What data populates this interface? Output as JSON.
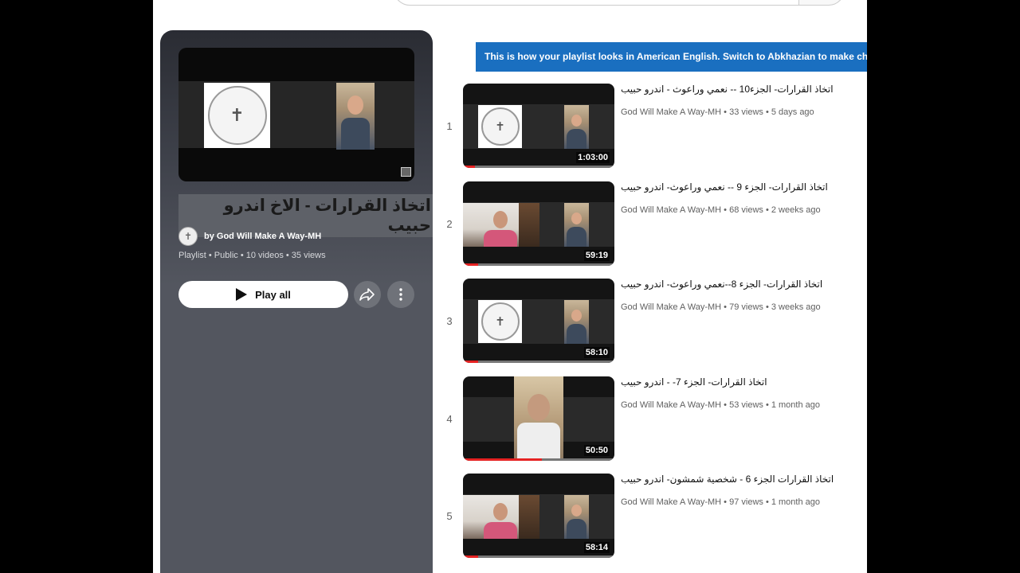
{
  "playlist": {
    "title": "اتخاذ القرارات - الاخ اندرو حبيب",
    "owner": "by God Will Make A Way-MH",
    "meta": "Playlist • Public • 10 videos • 35 views",
    "play_all_label": "Play all"
  },
  "banner": {
    "text": "This is how your playlist looks in American English. Switch to Abkhazian to make changes."
  },
  "icons": {
    "share": "share-icon",
    "more": "more-vert-icon",
    "play": "play-icon"
  },
  "videos": [
    {
      "index": "1",
      "title": "اتخاذ القرارات- الجزء10 -- نعمي وراعوث - اندرو حبيب",
      "channel": "God Will Make A Way-MH",
      "stats": "33 views • 5 days ago",
      "duration": "1:03:00",
      "progress": 0.08,
      "style": "logo"
    },
    {
      "index": "2",
      "title": "اتخاذ القرارات- الجزء 9 -- نعمي وراعوث- اندرو حبيب",
      "channel": "God Will Make A Way-MH",
      "stats": "68 views • 2 weeks ago",
      "duration": "59:19",
      "progress": 0.1,
      "style": "woman"
    },
    {
      "index": "3",
      "title": "اتخاذ القرارات- الجزء 8--نعمي وراعوث- اندرو حبيب",
      "channel": "God Will Make A Way-MH",
      "stats": "79 views • 3 weeks ago",
      "duration": "58:10",
      "progress": 0.1,
      "style": "logo"
    },
    {
      "index": "4",
      "title": "اتخاذ القرارات- الجزء 7- - اندرو حبيب",
      "channel": "God Will Make A Way-MH",
      "stats": "53 views • 1 month ago",
      "duration": "50:50",
      "progress": 0.52,
      "style": "man"
    },
    {
      "index": "5",
      "title": "اتخاذ القرارات الجزء 6 - شخصية شمشون- اندرو حبيب",
      "channel": "God Will Make A Way-MH",
      "stats": "97 views • 1 month ago",
      "duration": "58:14",
      "progress": 0.1,
      "style": "woman"
    }
  ]
}
